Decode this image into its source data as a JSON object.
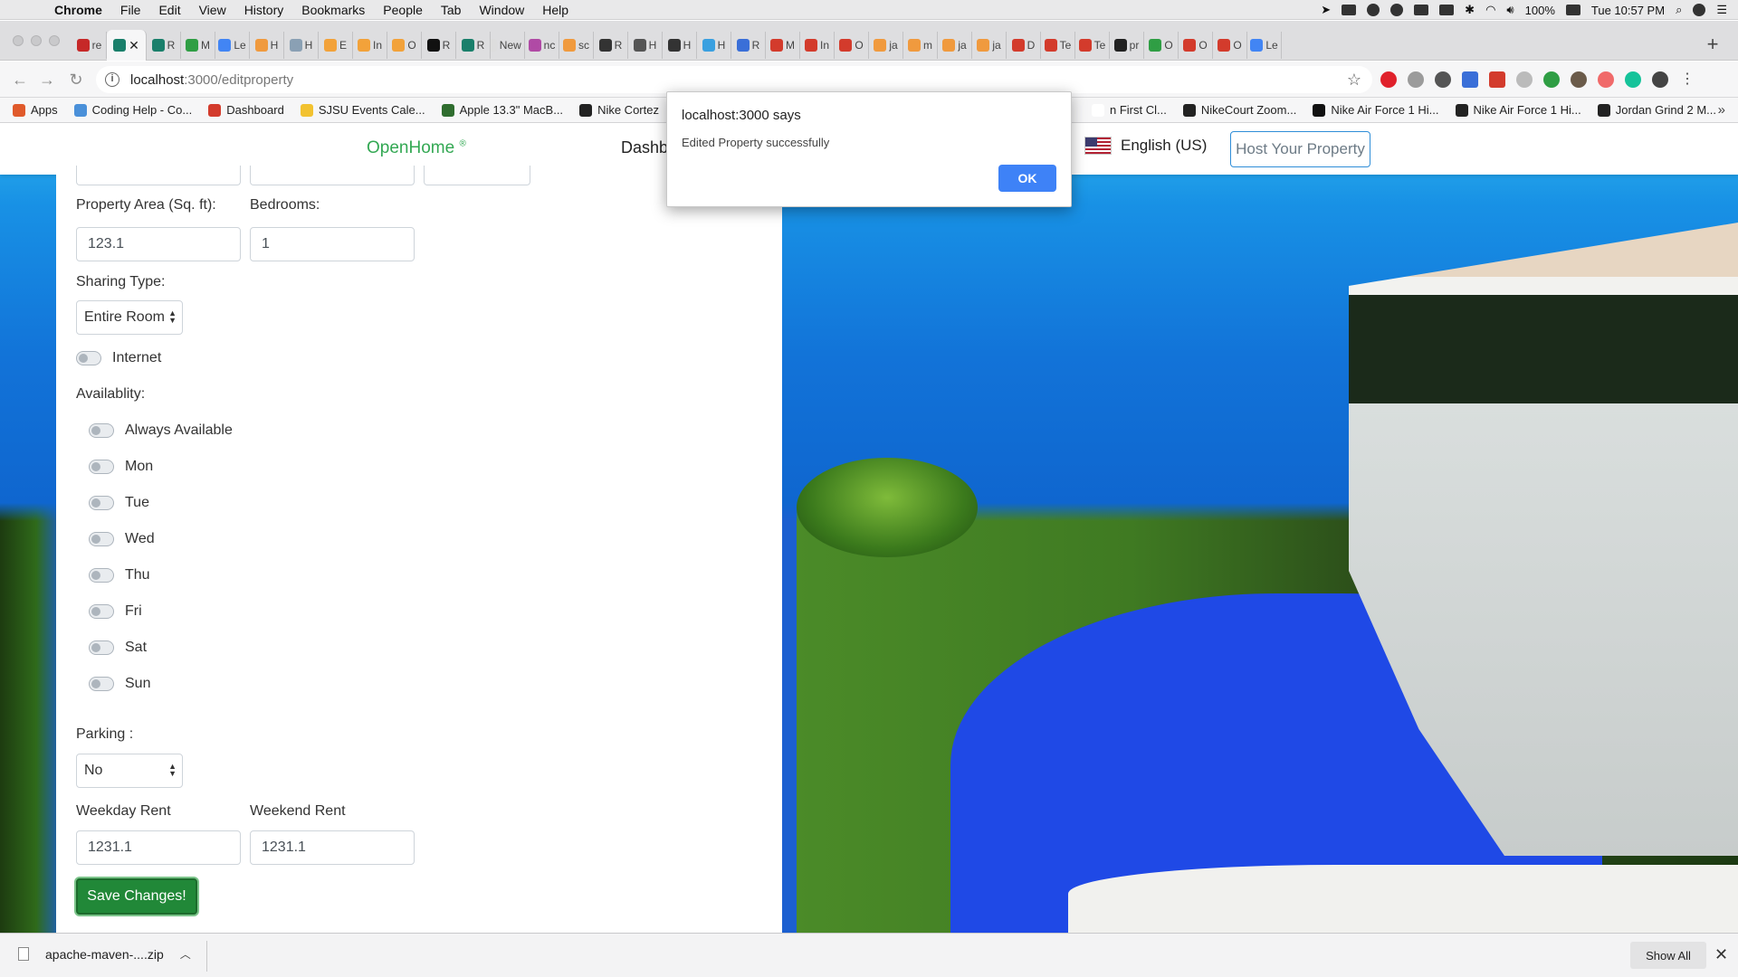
{
  "menubar": {
    "app": "Chrome",
    "items": [
      "File",
      "Edit",
      "View",
      "History",
      "Bookmarks",
      "People",
      "Tab",
      "Window",
      "Help"
    ],
    "battery": "100%",
    "clock": "Tue 10:57 PM"
  },
  "tabs": [
    {
      "label": "re",
      "color": "#c62828"
    },
    {
      "label": "",
      "color": "#1a7f6b",
      "active": true
    },
    {
      "label": "R",
      "color": "#1a7f6b"
    },
    {
      "label": "M",
      "color": "#2f9e44"
    },
    {
      "label": "Le",
      "color": "#4285f4"
    },
    {
      "label": "H",
      "color": "#f09a3e"
    },
    {
      "label": "H",
      "color": "#8aa0b4"
    },
    {
      "label": "E",
      "color": "#f2a23a"
    },
    {
      "label": "In",
      "color": "#f2a23a"
    },
    {
      "label": "O",
      "color": "#f2a23a"
    },
    {
      "label": "R",
      "color": "#111111"
    },
    {
      "label": "R",
      "color": "#1a7f6b"
    },
    {
      "label": "New T",
      "color": "#dddddd"
    },
    {
      "label": "nc",
      "color": "#b04aa5"
    },
    {
      "label": "sc",
      "color": "#f09a3e"
    },
    {
      "label": "R",
      "color": "#333333"
    },
    {
      "label": "H",
      "color": "#555555"
    },
    {
      "label": "H",
      "color": "#333333"
    },
    {
      "label": "H",
      "color": "#3aa0e0"
    },
    {
      "label": "R",
      "color": "#3a6fd8"
    },
    {
      "label": "M",
      "color": "#d33b2c"
    },
    {
      "label": "In",
      "color": "#d33b2c"
    },
    {
      "label": "O",
      "color": "#d33b2c"
    },
    {
      "label": "ja",
      "color": "#f09a3e"
    },
    {
      "label": "m",
      "color": "#f09a3e"
    },
    {
      "label": "ja",
      "color": "#f09a3e"
    },
    {
      "label": "ja",
      "color": "#f09a3e"
    },
    {
      "label": "D",
      "color": "#d33b2c"
    },
    {
      "label": "Te",
      "color": "#d33b2c"
    },
    {
      "label": "Te",
      "color": "#d33b2c"
    },
    {
      "label": "pr",
      "color": "#222222"
    },
    {
      "label": "O",
      "color": "#2f9e44"
    },
    {
      "label": "O",
      "color": "#d33b2c"
    },
    {
      "label": "O",
      "color": "#d33b2c"
    },
    {
      "label": "Le",
      "color": "#4285f4"
    }
  ],
  "address": {
    "host": "localhost",
    "path": ":3000/editproperty"
  },
  "bookmarks": [
    {
      "label": "Apps",
      "color": "#e05a2b"
    },
    {
      "label": "Coding Help - Co...",
      "color": "#4a90d9"
    },
    {
      "label": "Dashboard",
      "color": "#d33b2c"
    },
    {
      "label": "SJSU Events Cale...",
      "color": "#f2c230"
    },
    {
      "label": "Apple 13.3\" MacB...",
      "color": "#2f6d2f"
    },
    {
      "label": "Nike Cortez",
      "color": "#222222"
    },
    {
      "label": "n First Cl...",
      "color": "#ffffff"
    },
    {
      "label": "NikeCourt Zoom...",
      "color": "#222222"
    },
    {
      "label": "Nike Air Force 1 Hi...",
      "color": "#111111"
    },
    {
      "label": "Nike Air Force 1 Hi...",
      "color": "#222222"
    },
    {
      "label": "Jordan Grind 2 M...",
      "color": "#222222"
    }
  ],
  "navbar": {
    "brand": "OpenHome",
    "brand_mark": "®",
    "link": "Dashbo",
    "language": "English (US)",
    "host_button": "Host Your Property"
  },
  "form": {
    "area_label": "Property Area (Sq. ft):",
    "area_value": "123.1",
    "bedrooms_label": "Bedrooms:",
    "bedrooms_value": "1",
    "sharing_label": "Sharing Type:",
    "sharing_value": "Entire Room",
    "internet_label": "Internet",
    "availability_label": "Availablity:",
    "availability": [
      "Always Available",
      "Mon",
      "Tue",
      "Wed",
      "Thu",
      "Fri",
      "Sat",
      "Sun"
    ],
    "parking_label": "Parking :",
    "parking_value": "No",
    "weekday_label": "Weekday Rent",
    "weekday_value": "1231.1",
    "weekend_label": "Weekend Rent",
    "weekend_value": "1231.1",
    "save_label": "Save Changes!"
  },
  "dialog": {
    "title": "localhost:3000 says",
    "message": "Edited Property successfully",
    "ok_label": "OK"
  },
  "downloads": {
    "file": "apache-maven-....zip",
    "show_all": "Show All"
  }
}
